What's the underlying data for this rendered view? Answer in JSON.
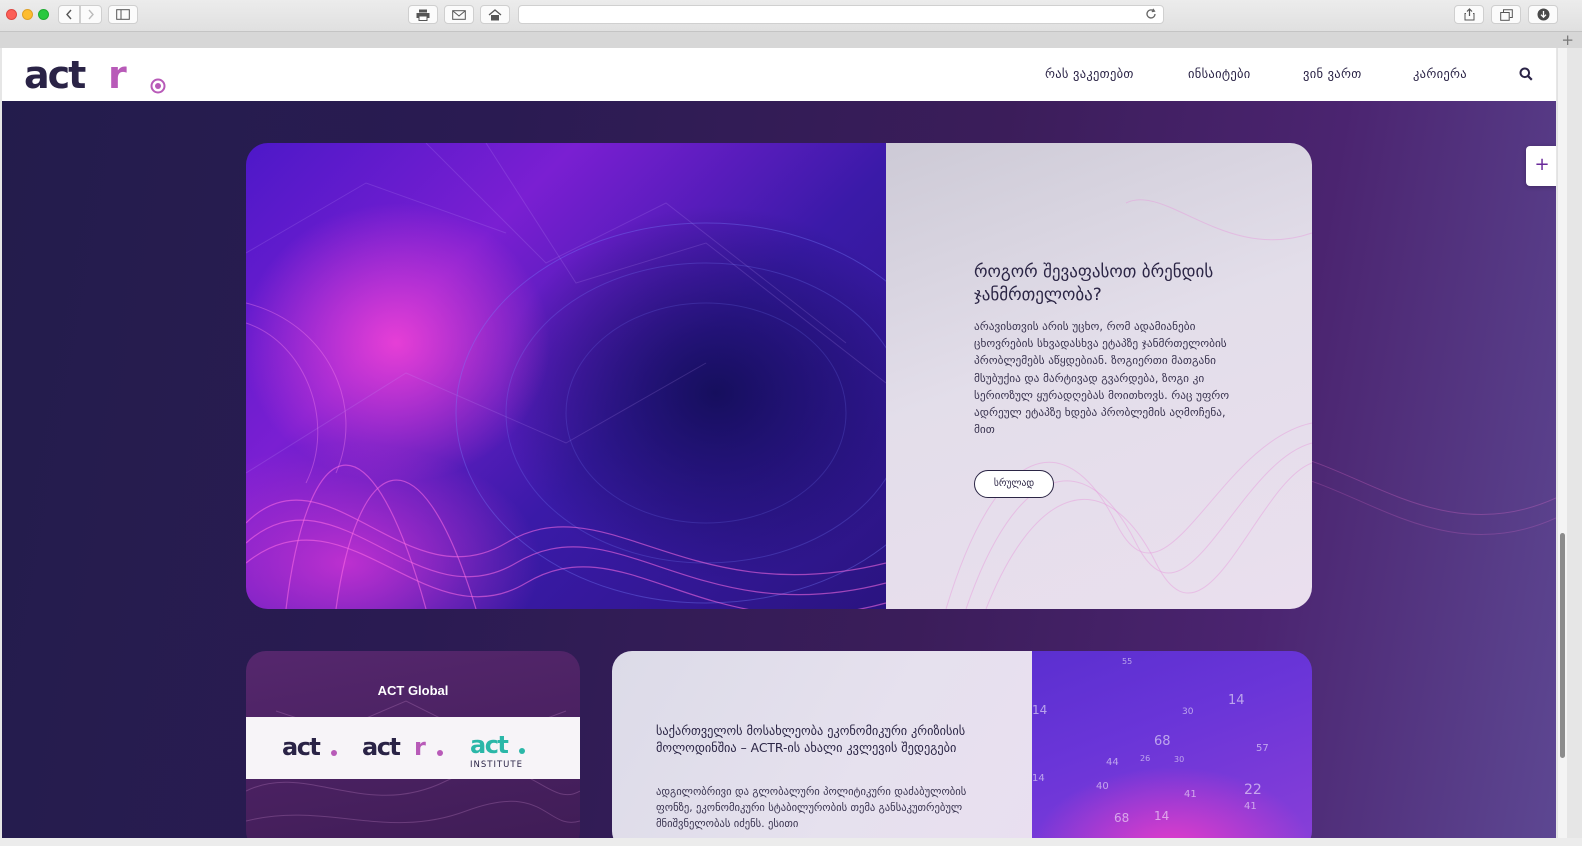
{
  "browser": {
    "url": ""
  },
  "header": {
    "nav": [
      {
        "label": "რას ვაკეთებთ"
      },
      {
        "label": "ინსაიტები"
      },
      {
        "label": "ვინ ვართ"
      },
      {
        "label": "კარიერა"
      }
    ]
  },
  "side_button": {
    "label": "+"
  },
  "hero": {
    "title": "როგორ შევაფასოთ ბრენდის ჯანმრთელობა?",
    "body": "არავისთვის არის უცხო, რომ ადამიანები ცხოვრების სხვადასხვა ეტაპზე ჯანმრთელობის პრობლემებს აწყდებიან. ზოგიერთი მათგანი მსუბუქია და მარტივად გვარდება, ზოგი კი სერიოზულ ყურადღებას მოითხოვს. რაც უფრო ადრეულ ეტაპზე ხდება პრობლემის აღმოჩენა, მით",
    "button": "სრულად"
  },
  "global": {
    "title": "ACT Global"
  },
  "news": {
    "title": "საქართველოს მოსახლეობა ეკონომიკური კრიზისის მოლოდინშია – ACTR-ის ახალი კვლევის შედეგები",
    "body": "ადგილობრივი და გლობალური პოლიტიკური დაძაბულობის ფონზე, ეკონომიკური სტაბილურობის თემა განსაკუთრებულ მნიშვნელობას იძენს. ესითი"
  },
  "colors": {
    "brand_dark": "#2a2346",
    "brand_magenta": "#b85ab8",
    "page_bg_left": "#231c4c",
    "page_bg_right": "#5d4792"
  }
}
